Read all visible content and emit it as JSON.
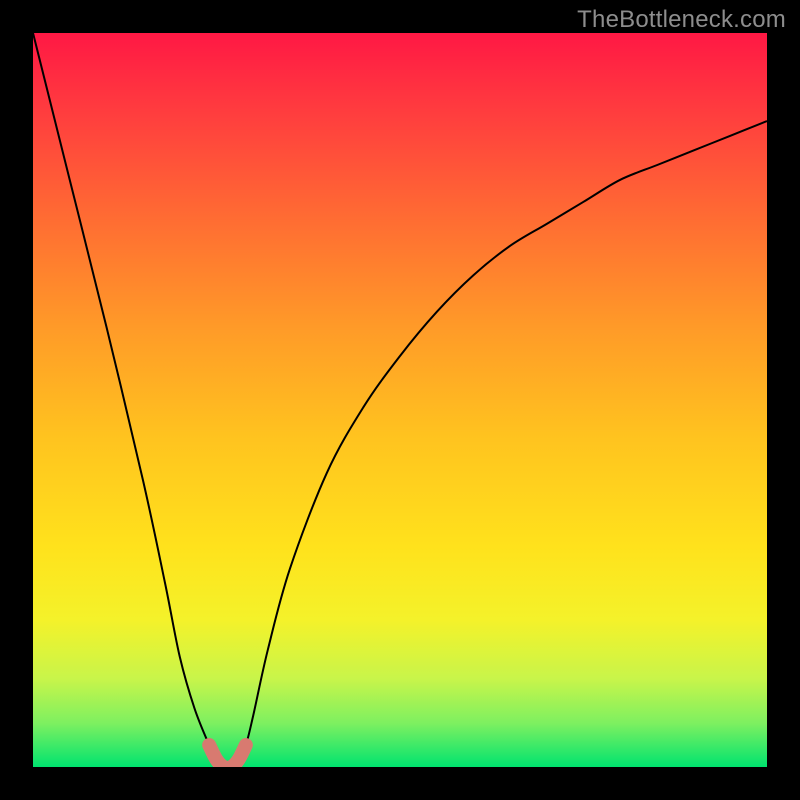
{
  "watermark": "TheBottleneck.com",
  "chart_data": {
    "type": "line",
    "title": "",
    "xlabel": "",
    "ylabel": "",
    "xlim": [
      0,
      100
    ],
    "ylim": [
      0,
      100
    ],
    "background_gradient": {
      "top_color": "#ff1844",
      "mid_color": "#ffd21c",
      "bottom_color": "#00e36f"
    },
    "series": [
      {
        "name": "bottleneck-curve",
        "x": [
          0,
          5,
          10,
          15,
          18,
          20,
          22,
          24,
          25,
          26,
          27,
          28,
          29,
          30,
          32,
          35,
          40,
          45,
          50,
          55,
          60,
          65,
          70,
          75,
          80,
          85,
          90,
          95,
          100
        ],
        "values": [
          100,
          80,
          60,
          39,
          25,
          15,
          8,
          3,
          1,
          0,
          0,
          1,
          3,
          7,
          16,
          27,
          40,
          49,
          56,
          62,
          67,
          71,
          74,
          77,
          80,
          82,
          84,
          86,
          88
        ]
      }
    ],
    "highlight": {
      "name": "minimum-region",
      "color": "#d87a70",
      "x_range": [
        23,
        30
      ],
      "y_range": [
        0,
        4
      ]
    },
    "annotations": []
  }
}
